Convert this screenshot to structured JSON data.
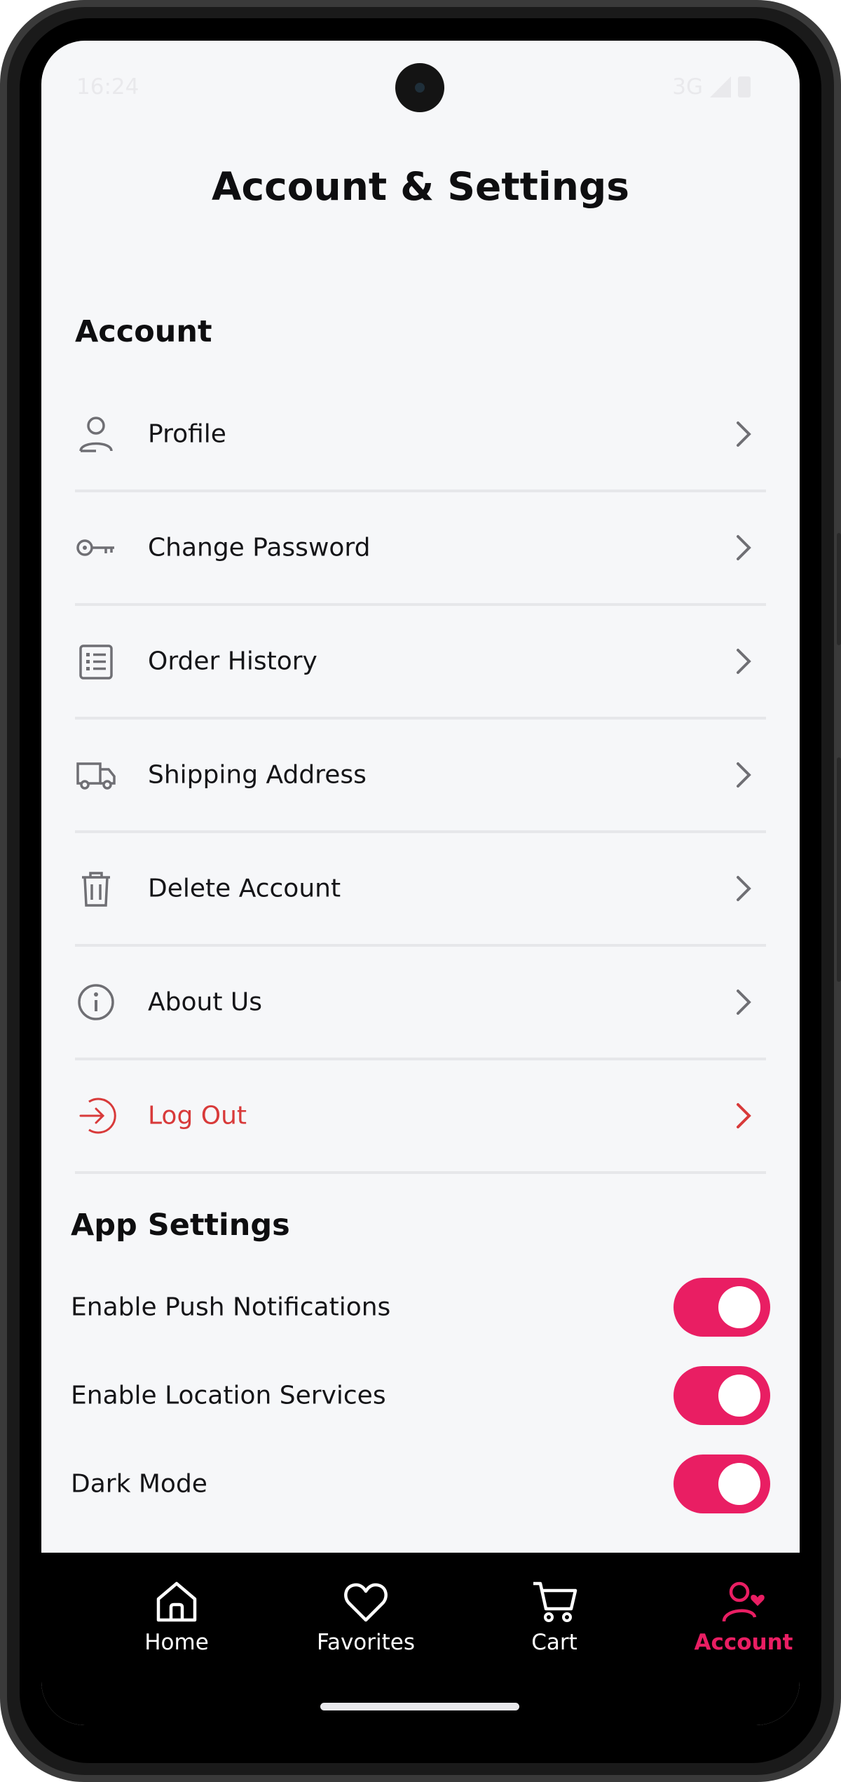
{
  "status_bar": {
    "time": "16:24",
    "network": "3G"
  },
  "page": {
    "title": "Account & Settings"
  },
  "account_section": {
    "heading": "Account",
    "items": [
      {
        "label": "Profile",
        "icon": "user-icon"
      },
      {
        "label": "Change Password",
        "icon": "key-icon"
      },
      {
        "label": "Order History",
        "icon": "list-icon"
      },
      {
        "label": "Shipping Address",
        "icon": "truck-icon"
      },
      {
        "label": "Delete Account",
        "icon": "trash-icon"
      },
      {
        "label": "About Us",
        "icon": "info-icon"
      },
      {
        "label": "Log Out",
        "icon": "logout-icon",
        "color": "#d83a3a"
      }
    ]
  },
  "app_settings": {
    "heading": "App Settings",
    "toggles": [
      {
        "label": "Enable Push Notifications",
        "enabled": true
      },
      {
        "label": "Enable Location Services",
        "enabled": true
      },
      {
        "label": "Dark Mode",
        "enabled": true
      }
    ]
  },
  "bottom_nav": {
    "items": [
      {
        "label": "Home",
        "icon": "home-icon"
      },
      {
        "label": "Favorites",
        "icon": "heart-icon"
      },
      {
        "label": "Cart",
        "icon": "cart-icon"
      },
      {
        "label": "Account",
        "icon": "account-heart-icon",
        "active": true
      }
    ]
  },
  "colors": {
    "accent": "#e91e63",
    "danger": "#d83a3a",
    "background": "#f6f7f9",
    "nav_background": "#000000"
  }
}
